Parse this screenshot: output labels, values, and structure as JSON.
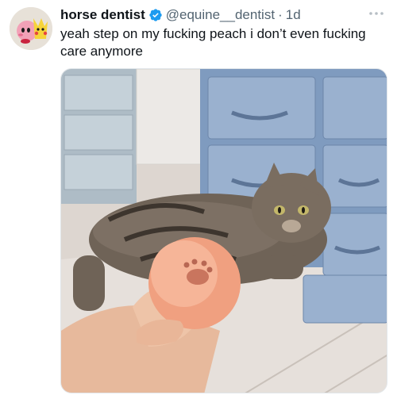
{
  "author": {
    "display_name": "horse dentist",
    "handle": "@equine__dentist",
    "separator": "·",
    "timestamp": "1d",
    "verified": true,
    "verified_color": "#1d9bf0"
  },
  "tweet": {
    "text": "yeah step on my fucking peach i don’t even fucking care anymore"
  },
  "icons": {
    "more": "more-horizontal-icon",
    "verified": "verified-badge-icon"
  },
  "colors": {
    "primary_text": "#0f1419",
    "secondary_text": "#536471",
    "accent": "#1d9bf0"
  }
}
